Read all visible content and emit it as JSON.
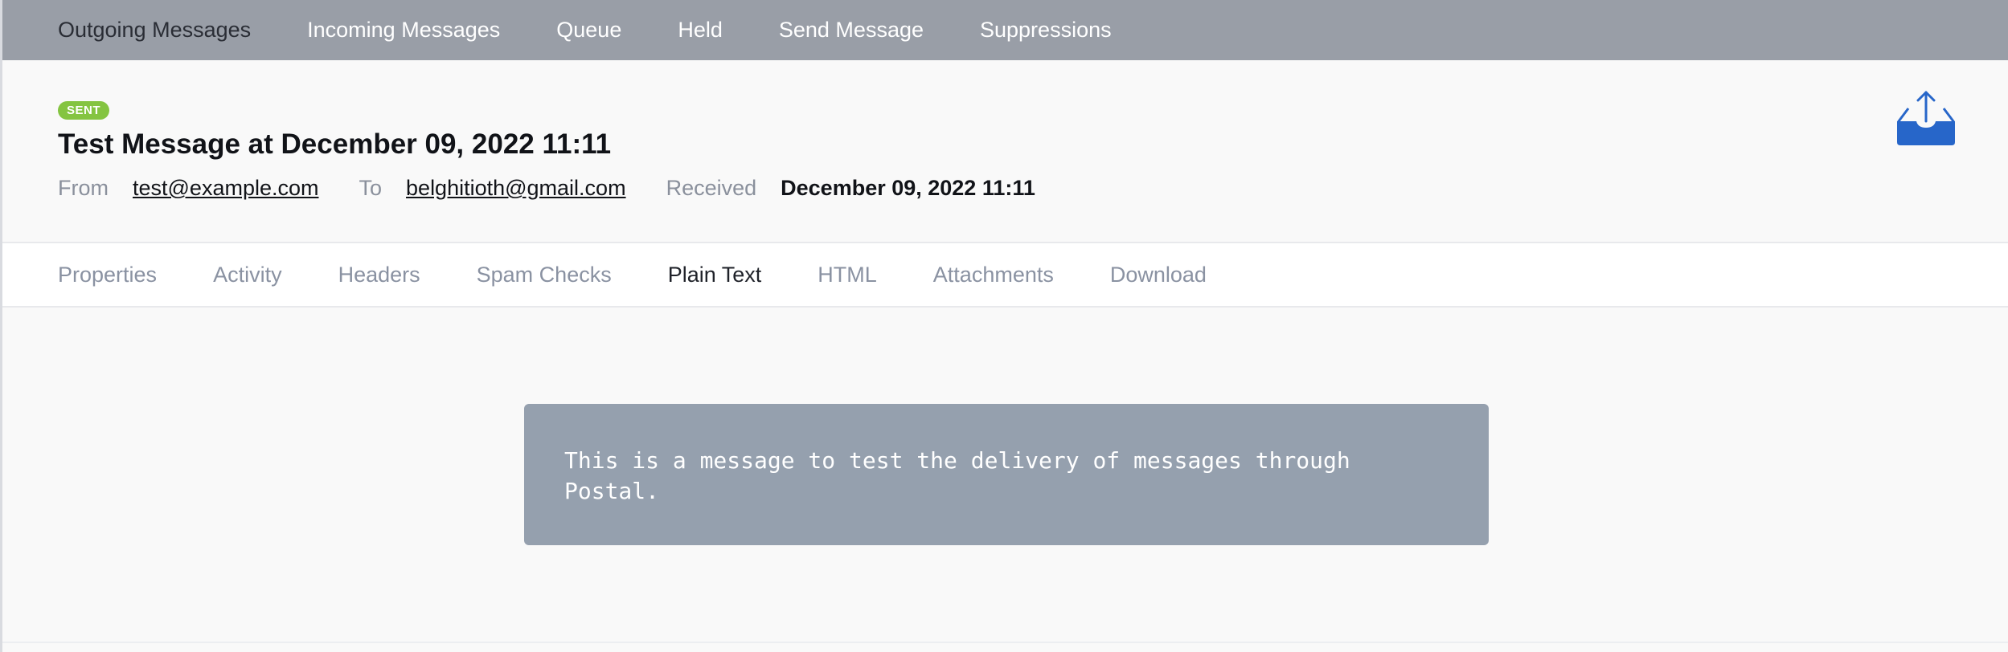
{
  "nav": {
    "items": [
      {
        "label": "Outgoing Messages",
        "active": true
      },
      {
        "label": "Incoming Messages",
        "active": false
      },
      {
        "label": "Queue",
        "active": false
      },
      {
        "label": "Held",
        "active": false
      },
      {
        "label": "Send Message",
        "active": false
      },
      {
        "label": "Suppressions",
        "active": false
      }
    ]
  },
  "message": {
    "status": "SENT",
    "subject": "Test Message at December 09, 2022 11:11",
    "from_label": "From",
    "from": "test@example.com",
    "to_label": "To",
    "to": "belghitioth@gmail.com",
    "received_label": "Received",
    "received": "December 09, 2022 11:11",
    "body": "This is a message to test the delivery of messages through\nPostal."
  },
  "tabs": {
    "items": [
      {
        "label": "Properties",
        "active": false
      },
      {
        "label": "Activity",
        "active": false
      },
      {
        "label": "Headers",
        "active": false
      },
      {
        "label": "Spam Checks",
        "active": false
      },
      {
        "label": "Plain Text",
        "active": true
      },
      {
        "label": "HTML",
        "active": false
      },
      {
        "label": "Attachments",
        "active": false
      },
      {
        "label": "Download",
        "active": false
      }
    ]
  },
  "icons": {
    "header_action": "outbox-upload-icon"
  },
  "colors": {
    "nav_bg": "#999ea7",
    "status_green": "#84c441",
    "icon_blue": "#2766c9",
    "message_box_bg": "#95a0ae"
  }
}
